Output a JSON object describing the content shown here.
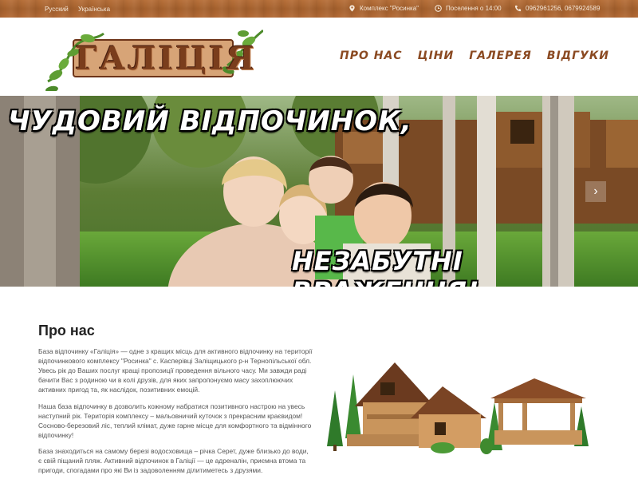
{
  "topbar": {
    "lang_ru": "Русский",
    "lang_uk": "Українська",
    "location": "Комплекс \"Росинка\"",
    "checkin": "Поселення о 14:00",
    "phones": "0962961256, 0679924589"
  },
  "header": {
    "logo_text": "ГАЛІЦІЯ",
    "nav": [
      "ПРО НАС",
      "ЦІНИ",
      "ГАЛЕРЕЯ",
      "ВІДГУКИ"
    ]
  },
  "hero": {
    "headline": "ЧУДОВИЙ ВІДПОЧИНОК,",
    "subline": "НЕЗАБУТНІ ВРАЖЕННЯ!",
    "next_icon": "chevron-right-icon"
  },
  "about": {
    "title": "Про нас",
    "p1": "База відпочинку «Галіція» — одне з кращих місць для активного відпочинку на території відпочинкового комплексу \"Росинка\" с. Касперівці Заліщицького р-н Тернопільської обл. Увесь рік до Ваших послуг кращі пропозиції проведення вільного часу. Ми завжди раді бачити Вас з родиною чи в колі друзів, для яких запропонуємо масу захоплюючих активних пригод та, як наслідок, позитивних емоцій.",
    "p2": "Наша база відпочинку в дозволить кожному набратися позитивного настрою на увесь наступний рік. Територія комплексу – мальовничий куточок з прекрасним краєвидом! Сосново-березовий ліс, теплий клімат, дуже гарне місце для комфортного та відмінного відпочинку!",
    "p3": "База знаходиться на самому березі водосховища – річка Серет, дуже близько до води, є свій піщаний пляж. Активний відпочинок в Галіції — це адреналін, приємна втома та пригоди, спогадами про які Ви із задоволенням ділитиметесь з друзями."
  },
  "colors": {
    "wood_bar": "#b0683a",
    "nav_brown": "#8b4a22",
    "logo_brown": "#7a3d1c",
    "leaf_green": "#4c8a2a"
  }
}
